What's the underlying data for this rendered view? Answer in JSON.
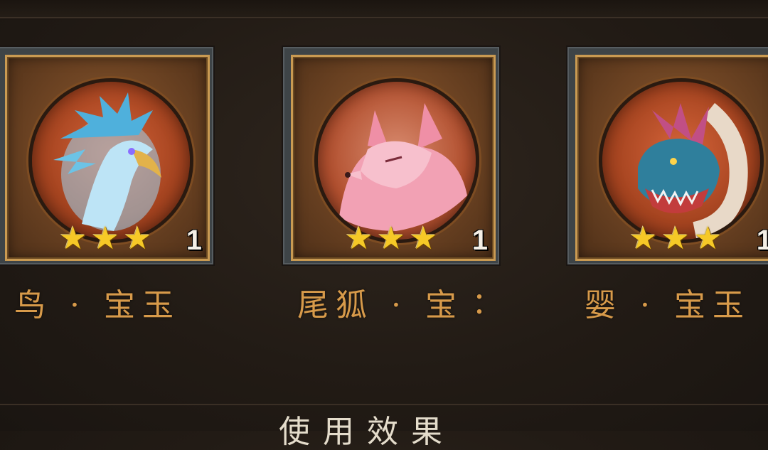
{
  "colors": {
    "name_text": "#d79a4a",
    "star": "#f6c927",
    "frame_gold": "#c99a52",
    "background": "#221b15"
  },
  "cards": [
    {
      "name": "鸟 · 宝玉",
      "stars": 3,
      "star_glyph": "★",
      "count": "1",
      "icon": "blue-phoenix-bird-icon"
    },
    {
      "name": "尾狐 · 宝∶",
      "stars": 3,
      "star_glyph": "★",
      "count": "1",
      "icon": "pink-fox-icon"
    },
    {
      "name": "婴 · 宝玉",
      "stars": 3,
      "star_glyph": "★",
      "count": "1",
      "icon": "blue-dragon-icon"
    }
  ],
  "footer": {
    "label": "使用效果"
  }
}
